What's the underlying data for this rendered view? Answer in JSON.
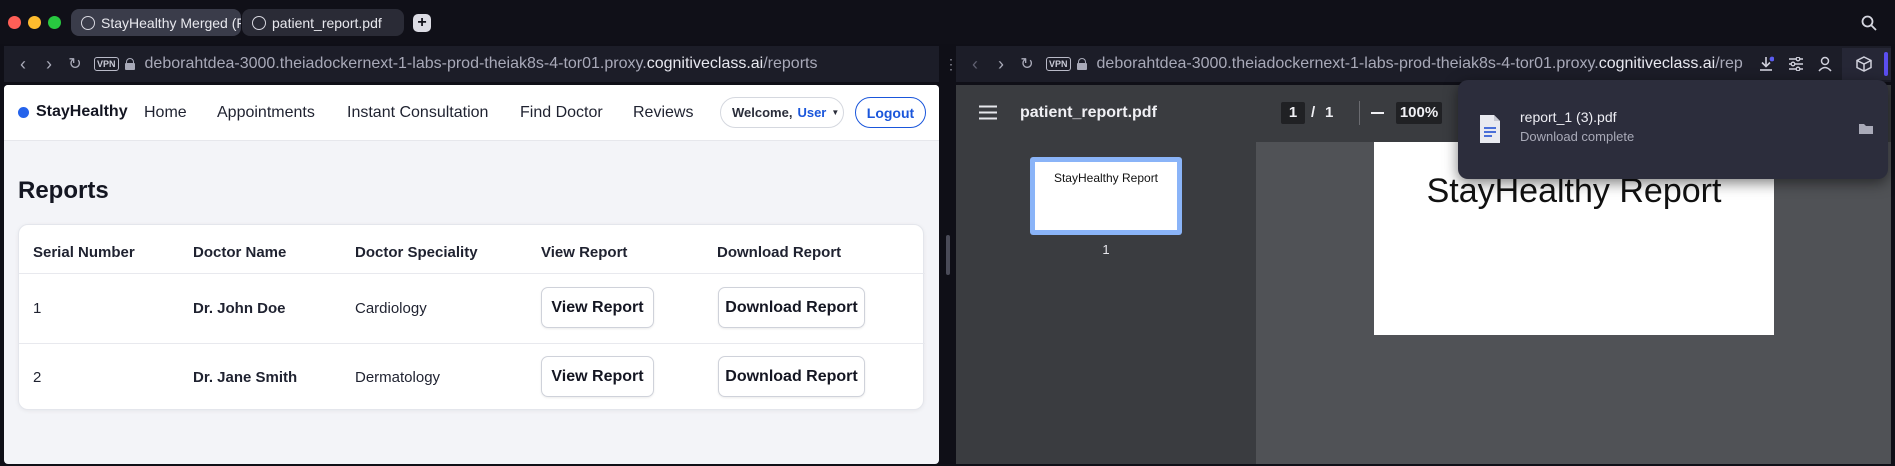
{
  "browser": {
    "tabs": [
      {
        "label": "StayHealthy Merged (F"
      },
      {
        "label": "patient_report.pdf"
      }
    ],
    "left_url": {
      "prefix": "deborahtdea-3000.theiadockernext-1-labs-prod-theiak8s-4-tor01.proxy.",
      "host": "cognitiveclass.ai",
      "path": "/reports"
    },
    "right_url": {
      "prefix": "deborahtdea-3000.theiadockernext-1-labs-prod-theiak8s-4-tor01.proxy.",
      "host": "cognitiveclass.ai",
      "path": "/rep"
    },
    "vpn_label": "VPN"
  },
  "site": {
    "brand": "StayHealthy",
    "nav": [
      "Home",
      "Appointments",
      "Instant Consultation",
      "Find Doctor",
      "Reviews"
    ],
    "welcome": "Welcome,",
    "user": "User",
    "logout": "Logout",
    "page_title": "Reports",
    "table": {
      "headers": [
        "Serial Number",
        "Doctor Name",
        "Doctor Speciality",
        "View Report",
        "Download Report"
      ],
      "rows": [
        {
          "serial": "1",
          "doctor": "Dr. John Doe",
          "speciality": "Cardiology",
          "view": "View Report",
          "download": "Download Report"
        },
        {
          "serial": "2",
          "doctor": "Dr. Jane Smith",
          "speciality": "Dermatology",
          "view": "View Report",
          "download": "Download Report"
        }
      ]
    }
  },
  "pdf": {
    "filename": "patient_report.pdf",
    "page_current": "1",
    "page_sep": "/",
    "page_total": "1",
    "zoom": "100%",
    "thumb_text": "StayHealthy Report",
    "thumb_number": "1",
    "page_heading": "StayHealthy Report"
  },
  "download": {
    "filename": "report_1 (3).pdf",
    "status": "Download complete"
  },
  "colors": {
    "accent_blue": "#1a56db",
    "brand_dot": "#2563eb"
  }
}
